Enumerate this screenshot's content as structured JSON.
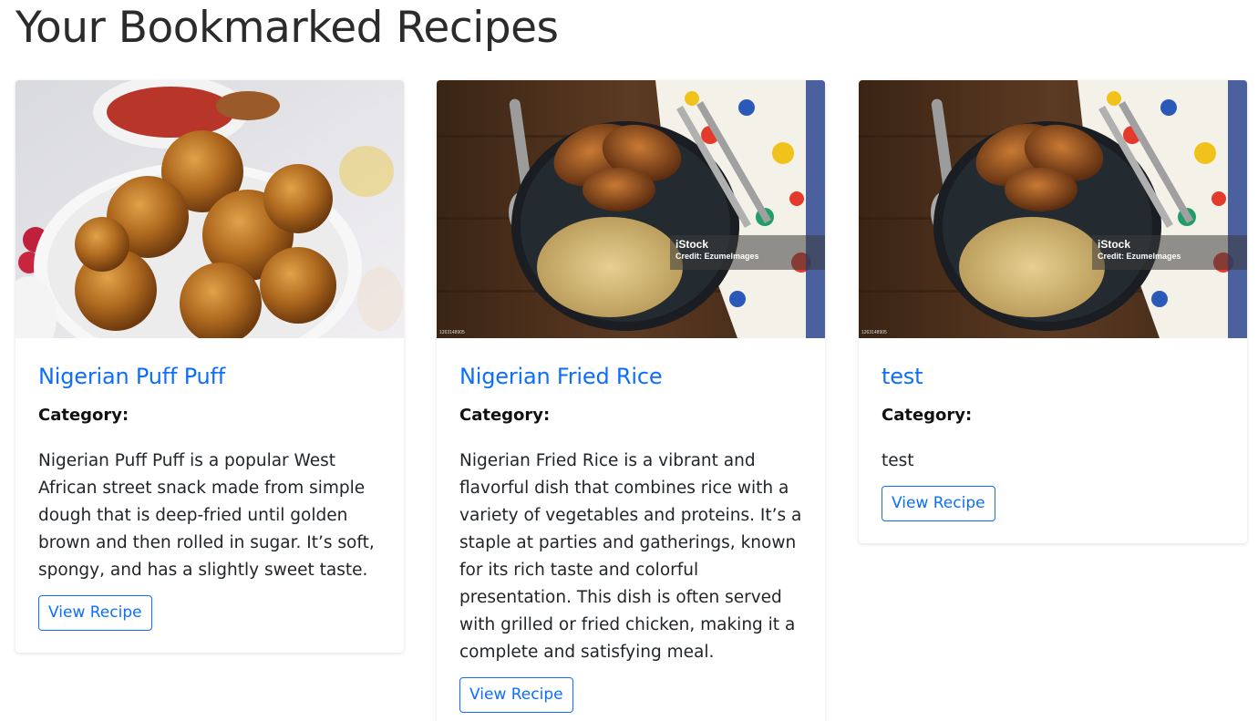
{
  "page": {
    "title": "Your Bookmarked Recipes"
  },
  "colors": {
    "accent": "#0d6efd",
    "text": "#212529",
    "heading": "#2b2b2b"
  },
  "recipes": [
    {
      "title": "Nigerian Puff Puff",
      "category_label": "Category:",
      "description": "Nigerian Puff Puff is a popular West African street snack made from simple dough that is deep-fried until golden brown and then rolled in sugar. It’s soft, spongy, and has a slightly sweet taste.",
      "button_label": "View Recipe",
      "image": "puff-puff-photo"
    },
    {
      "title": "Nigerian Fried Rice",
      "category_label": "Category:",
      "description": "Nigerian Fried Rice is a vibrant and flavorful dish that combines rice with a variety of vegetables and proteins. It’s a staple at parties and gatherings, known for its rich taste and colorful presentation. This dish is often served with grilled or fried chicken, making it a complete and satisfying meal.",
      "button_label": "View Recipe",
      "image": "fried-rice-photo",
      "watermark_brand": "iStock",
      "watermark_credit": "Credit: EzumeImages",
      "image_id": "1263148905"
    },
    {
      "title": "test",
      "category_label": "Category:",
      "description": "test",
      "button_label": "View Recipe",
      "image": "fried-rice-photo",
      "watermark_brand": "iStock",
      "watermark_credit": "Credit: EzumeImages",
      "image_id": "1263148905"
    }
  ]
}
